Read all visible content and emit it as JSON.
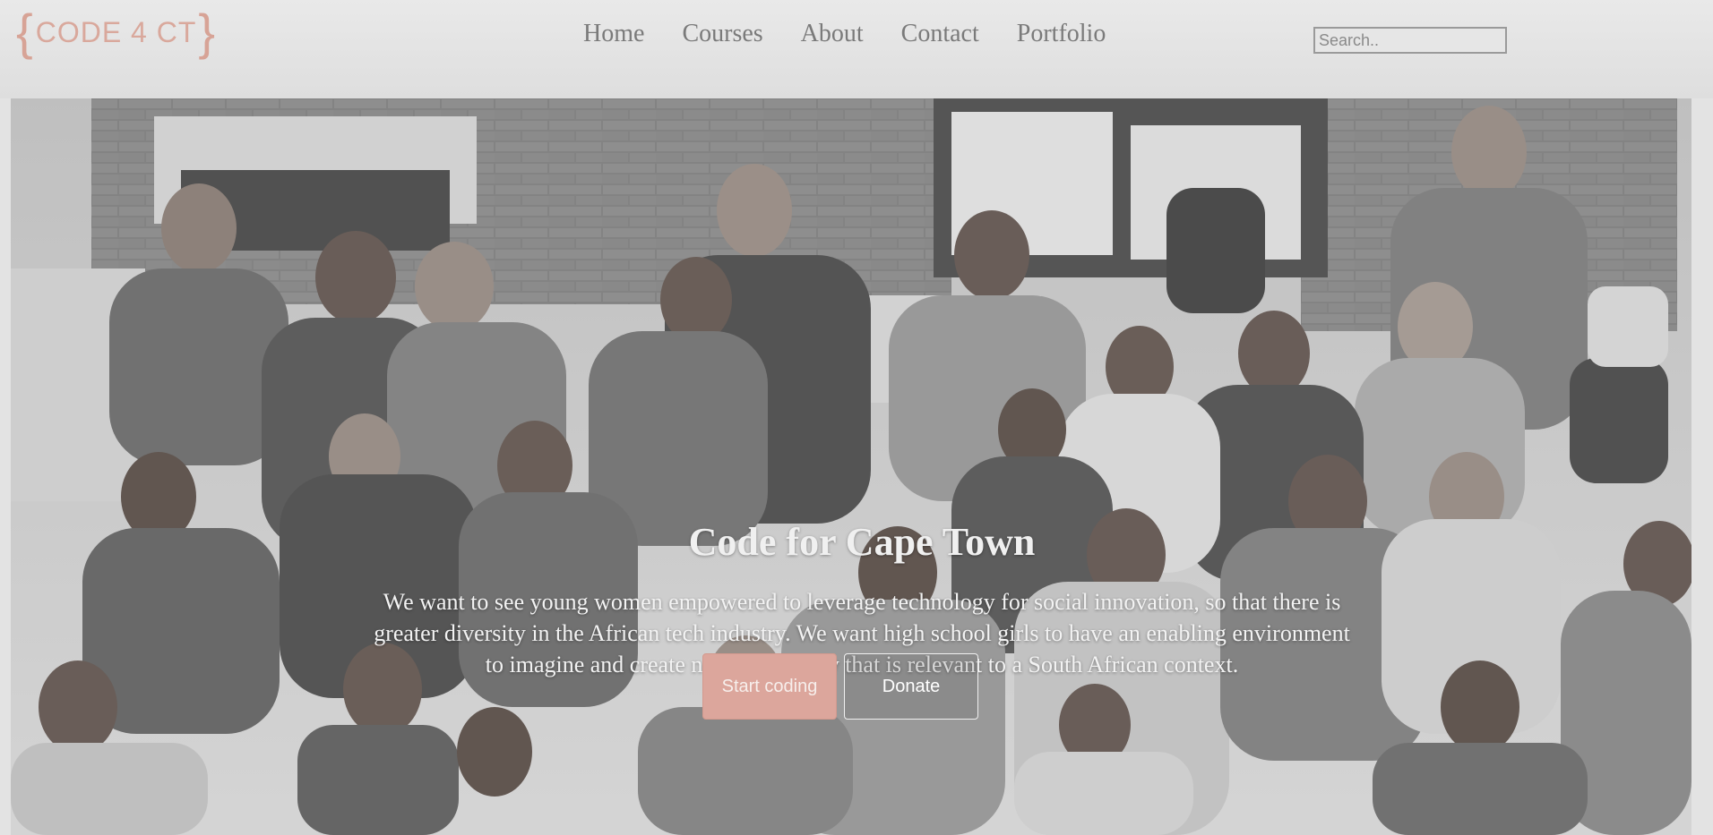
{
  "header": {
    "logo_text": "CODE 4 CT",
    "nav": [
      {
        "label": "Home"
      },
      {
        "label": "Courses"
      },
      {
        "label": "About"
      },
      {
        "label": "Contact"
      },
      {
        "label": "Portfolio"
      }
    ],
    "search": {
      "placeholder": "Search..",
      "value": ""
    }
  },
  "hero": {
    "title": "Code for Cape Town",
    "text": "We want to see young women empowered to leverage technology for social innovation, so that there is greater diversity in the African tech industry. We want high school girls to have an enabling environment to imagine and create new technology that is relevant to a South African context.",
    "buttons": {
      "primary_label": "Start coding",
      "secondary_label": "Donate"
    }
  },
  "colors": {
    "accent": "#dca69c",
    "nav_text": "#7a7a7a",
    "header_bg": "#e4e4e4"
  }
}
